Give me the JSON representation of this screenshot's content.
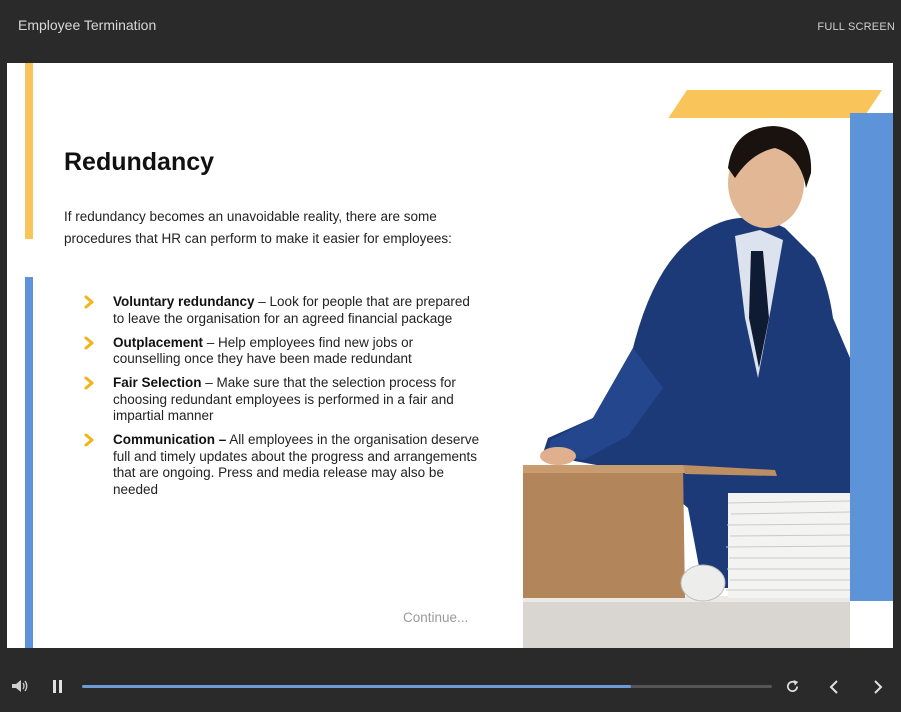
{
  "header": {
    "course_title": "Employee Termination",
    "fullscreen_label": "FULL SCREEN"
  },
  "slide": {
    "heading": "Redundancy",
    "intro": "If redundancy becomes an unavoidable reality, there are some procedures that HR can perform to make it easier for employees:",
    "bullets": [
      {
        "term": "Voluntary redundancy",
        "text": " – Look for people that are prepared to leave the organisation for an agreed financial package"
      },
      {
        "term": "Outplacement",
        "text": " – Help employees find new jobs or counselling once they have been made redundant"
      },
      {
        "term": "Fair Selection",
        "text": " – Make sure that the selection process for choosing redundant employees is performed in a fair and impartial manner"
      },
      {
        "term": "Communication –",
        "text": " All employees in the organisation deserve full and timely updates about the progress and arrangements that are ongoing. Press and media release may also be needed"
      }
    ],
    "continue_label": "Continue...",
    "image_icon": "businessman-packing-box-photo"
  },
  "player": {
    "progress_fraction": 0.795,
    "icons": {
      "volume": "volume-icon",
      "pause": "pause-icon",
      "replay": "replay-icon",
      "prev": "chevron-left-icon",
      "next": "chevron-right-icon"
    }
  },
  "colors": {
    "accent_yellow": "#f9c45a",
    "accent_blue": "#5d93d8",
    "progress": "#6c9bd6",
    "chrome": "#2a2a2a"
  }
}
